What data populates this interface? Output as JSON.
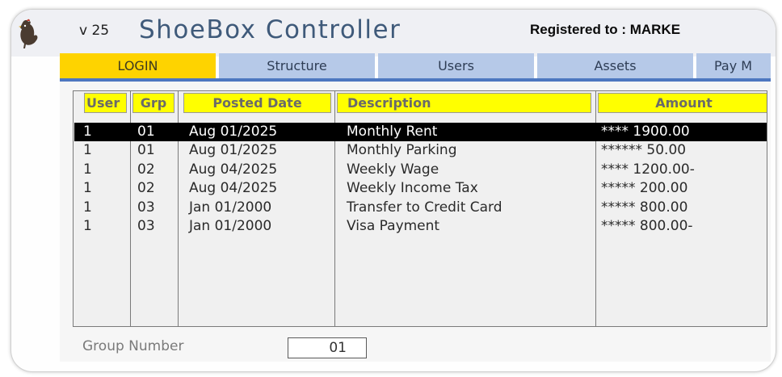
{
  "header": {
    "version": "v 25",
    "title": "ShoeBox Controller",
    "registered": "Registered to : MARKE"
  },
  "tabs": [
    {
      "label": "LOGIN",
      "active": true
    },
    {
      "label": "Structure",
      "active": false
    },
    {
      "label": "Users",
      "active": false
    },
    {
      "label": "Assets",
      "active": false
    },
    {
      "label": "Pay M",
      "active": false
    }
  ],
  "table": {
    "columns": [
      "User",
      "Grp",
      "Posted Date",
      "Description",
      "Amount"
    ],
    "rows": [
      {
        "user": "1",
        "grp": "01",
        "date": "Aug 01/2025",
        "description": "Monthly Rent",
        "amount": "**** 1900.00",
        "selected": true
      },
      {
        "user": "1",
        "grp": "01",
        "date": "Aug 01/2025",
        "description": "Monthly Parking",
        "amount": "****** 50.00",
        "selected": false
      },
      {
        "user": "1",
        "grp": "02",
        "date": "Aug 04/2025",
        "description": "Weekly Wage",
        "amount": "**** 1200.00-",
        "selected": false
      },
      {
        "user": "1",
        "grp": "02",
        "date": "Aug 04/2025",
        "description": "Weekly Income Tax",
        "amount": "***** 200.00",
        "selected": false
      },
      {
        "user": "1",
        "grp": "03",
        "date": "Jan 01/2000",
        "description": "Transfer to Credit Card",
        "amount": "***** 800.00",
        "selected": false
      },
      {
        "user": "1",
        "grp": "03",
        "date": "Jan 01/2000",
        "description": "Visa Payment",
        "amount": "***** 800.00-",
        "selected": false
      }
    ]
  },
  "group_number": {
    "label": "Group Number",
    "value": "01"
  },
  "colors": {
    "active_tab": "#fed300",
    "inactive_tab": "#b6c9e8",
    "header_yellow": "#ffff00",
    "title_blue": "#3f5a7a",
    "tab_underline": "#4d77c0"
  },
  "icons": {
    "logo": "rooster-logo-icon"
  }
}
